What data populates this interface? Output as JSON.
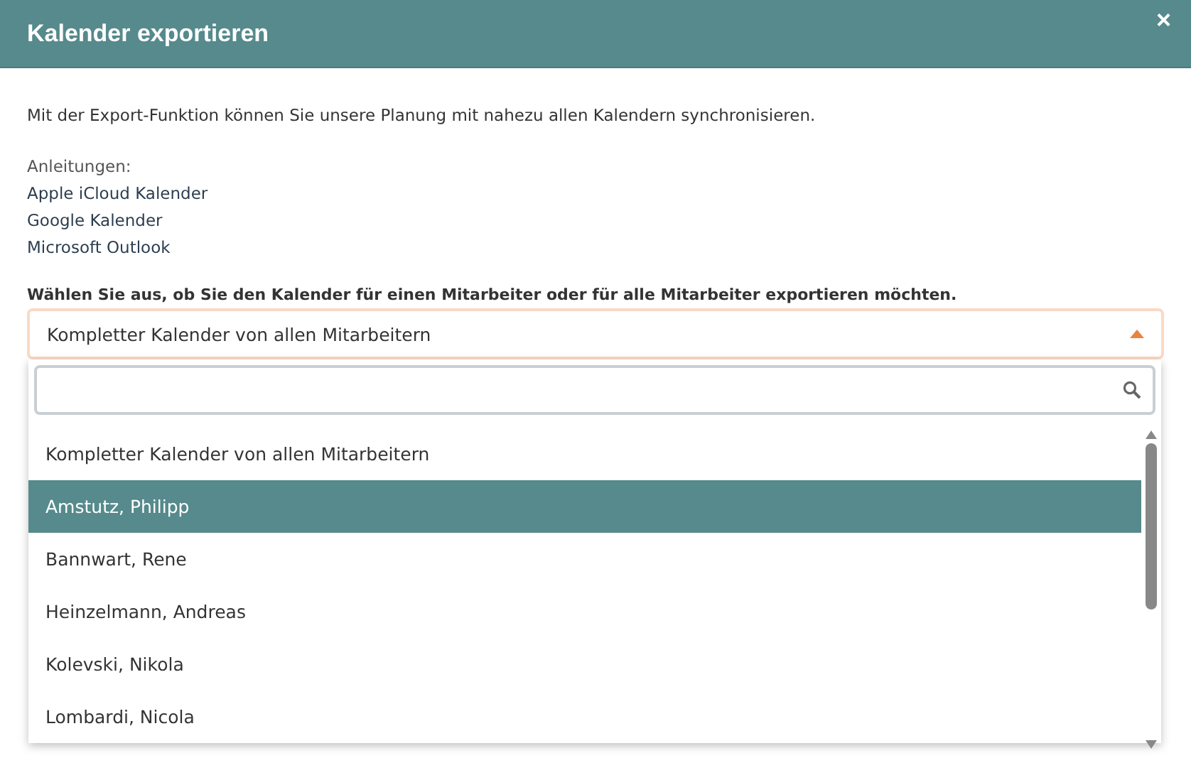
{
  "window": {
    "title": "Kalender exportieren",
    "close": "×"
  },
  "intro": "Mit der Export-Funktion können Sie unsere Planung mit nahezu allen Kalendern synchronisieren.",
  "guides": {
    "heading": "Anleitungen:",
    "links": [
      "Apple iCloud Kalender",
      "Google Kalender",
      "Microsoft Outlook"
    ]
  },
  "prompt": "Wählen Sie aus, ob Sie den Kalender für einen Mitarbeiter oder für alle Mitarbeiter exportieren möchten.",
  "select": {
    "value": "Kompletter Kalender von allen Mitarbeitern",
    "expanded": true
  },
  "dropdown": {
    "options": [
      {
        "label": "Kompletter Kalender von allen Mitarbeitern",
        "selected": false
      },
      {
        "label": "Amstutz, Philipp",
        "selected": true
      },
      {
        "label": "Bannwart, Rene",
        "selected": false
      },
      {
        "label": "Heinzelmann, Andreas",
        "selected": false
      },
      {
        "label": "Kolevski, Nikola",
        "selected": false
      },
      {
        "label": "Lombardi, Nicola",
        "selected": false
      }
    ]
  }
}
